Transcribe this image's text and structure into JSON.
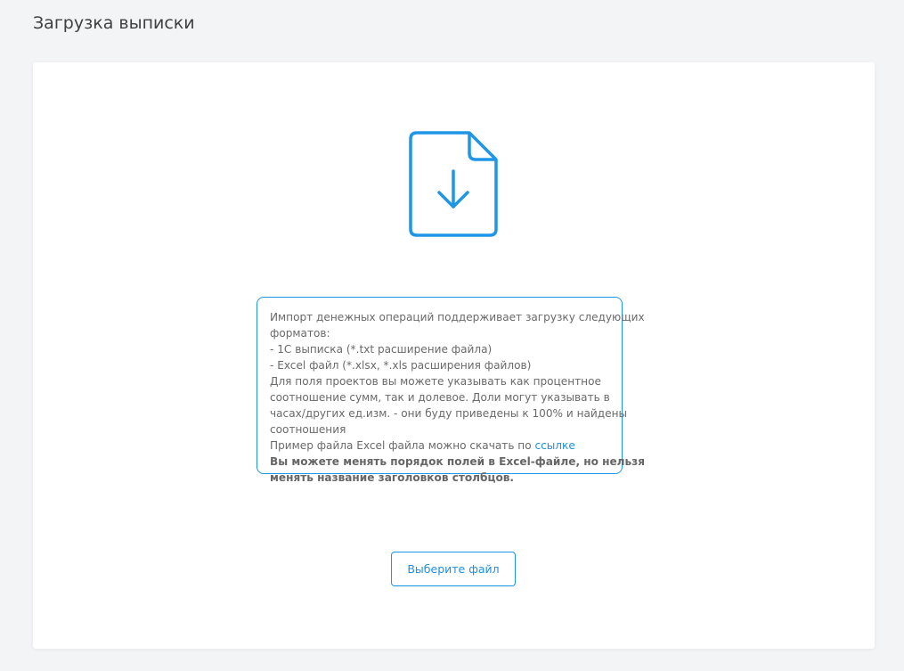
{
  "page": {
    "title": "Загрузка выписки"
  },
  "upload": {
    "icon": "file-download-icon",
    "accent_color": "#1e95e6",
    "info": {
      "line1": "Импорт денежных операций поддерживает загрузку следующих",
      "line2": "форматов:",
      "line3": "- 1С выписка (*.txt расширение файла)",
      "line4": "- Excel файл (*.xlsx, *.xls расширения файлов)",
      "line5": "Для поля проектов вы можете указывать как процентное",
      "line6": "соотношение сумм, так и долевое. Доли могут указывать в",
      "line7": "часах/других ед.изм. - они буду приведены к 100% и найдены",
      "line8": "соотношения",
      "line9_prefix": "Пример файла Excel файла можно скачать по ",
      "line9_link": "ссылке",
      "bold1": "Вы можете менять порядок полей в Excel-файле, но нельзя",
      "bold2": "менять название заголовков столбцов."
    },
    "button_label": "Выберите файл"
  }
}
